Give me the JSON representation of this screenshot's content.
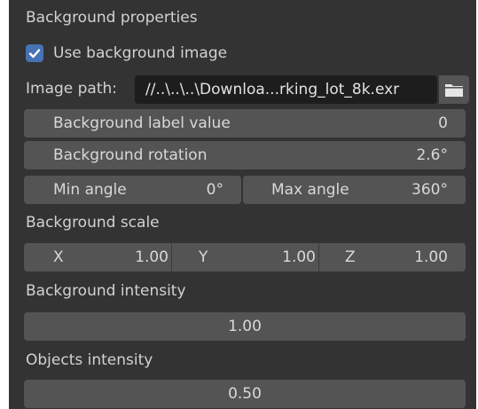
{
  "section_title": "Background properties",
  "use_bg": {
    "label": "Use background image",
    "checked": true
  },
  "image_path": {
    "label": "Image path:",
    "value": "//..\\..\\..\\Downloa...rking_lot_8k.exr"
  },
  "bg_label_value": {
    "label": "Background label value",
    "value": "0"
  },
  "bg_rotation": {
    "label": "Background rotation",
    "value": "2.6°"
  },
  "angles": {
    "min_label": "Min angle",
    "min_value": "0°",
    "max_label": "Max angle",
    "max_value": "360°"
  },
  "bg_scale": {
    "title": "Background scale",
    "x_label": "X",
    "x_value": "1.00",
    "y_label": "Y",
    "y_value": "1.00",
    "z_label": "Z",
    "z_value": "1.00"
  },
  "bg_intensity": {
    "title": "Background intensity",
    "value": "1.00"
  },
  "obj_intensity": {
    "title": "Objects intensity",
    "value": "0.50"
  },
  "icons": {
    "checkbox": "check-icon",
    "folder": "folder-icon"
  },
  "colors": {
    "panel": "#333333",
    "field": "#545454",
    "path_field": "#1d1d1d",
    "accent": "#4772b3"
  }
}
